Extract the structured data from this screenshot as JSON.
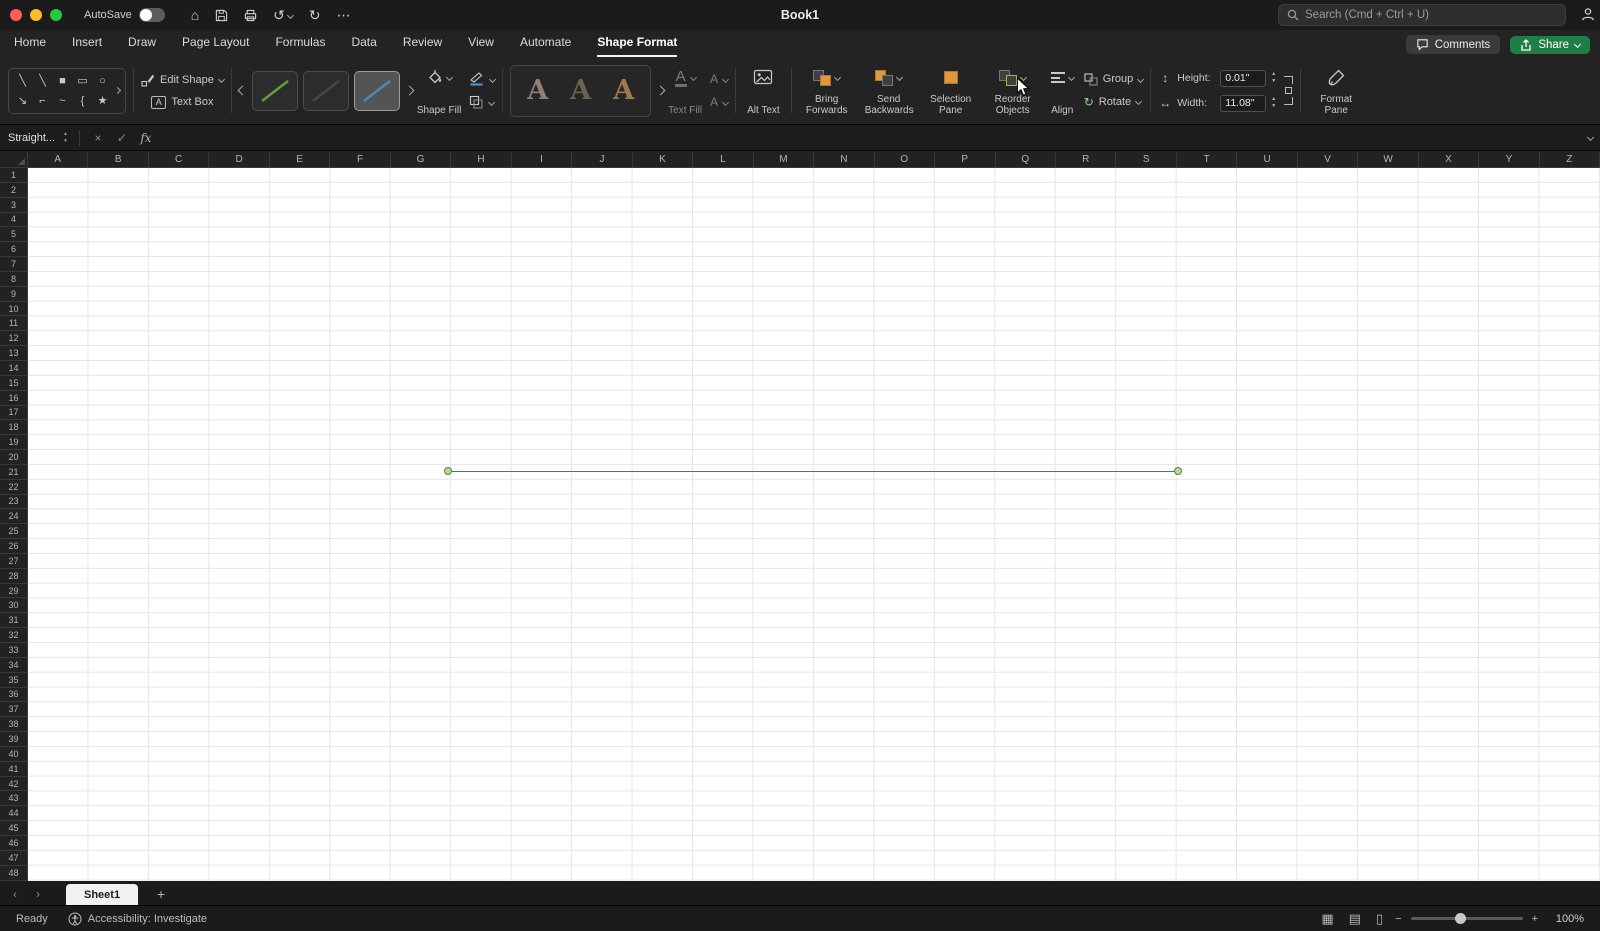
{
  "colors": {
    "share_button_green": "#1e7e45",
    "selected_line_blue": "#41719c",
    "selection_handle_green": "#b9d9a2",
    "selection_handle_border": "#56812f",
    "arrange_icon_orange": "#e0973f",
    "traffic_red": "#ff5f57",
    "traffic_yellow": "#febc2e",
    "traffic_green": "#28c840"
  },
  "icons": {
    "home": "⌂",
    "undo": "↺",
    "redo": "↻",
    "more": "⋯",
    "cancel": "×",
    "confirm": "✓",
    "stepper_up": "▲",
    "stepper_down": "▼",
    "nav_left": "‹",
    "nav_right": "›",
    "add_sheet": "+",
    "zoom_out": "−",
    "zoom_in": "+",
    "view_normal": "▦",
    "view_page_layout": "▤",
    "view_page_break": "▯",
    "height_arrow": "↕",
    "width_arrow": "↔",
    "rotate": "↻",
    "letter_a": "A"
  },
  "titlebar": {
    "autosave_label": "AutoSave",
    "document_title": "Book1",
    "search_placeholder": "Search (Cmd + Ctrl + U)"
  },
  "ribbon_tabs": {
    "items": [
      {
        "label": "Home",
        "active": false
      },
      {
        "label": "Insert",
        "active": false
      },
      {
        "label": "Draw",
        "active": false
      },
      {
        "label": "Page Layout",
        "active": false
      },
      {
        "label": "Formulas",
        "active": false
      },
      {
        "label": "Data",
        "active": false
      },
      {
        "label": "Review",
        "active": false
      },
      {
        "label": "View",
        "active": false
      },
      {
        "label": "Automate",
        "active": false
      },
      {
        "label": "Shape Format",
        "active": true
      }
    ],
    "comments_label": "Comments",
    "share_label": "Share"
  },
  "ribbon": {
    "insert_shapes": {
      "row1": [
        {
          "name": "line-icon",
          "glyph": "╲"
        },
        {
          "name": "line-arrow-icon",
          "glyph": "╲"
        },
        {
          "name": "rectangle-filled-icon",
          "glyph": "■"
        },
        {
          "name": "rectangle-icon",
          "glyph": "▭"
        },
        {
          "name": "oval-icon",
          "glyph": "○"
        }
      ],
      "row2": [
        {
          "name": "arrow-icon",
          "glyph": "↘"
        },
        {
          "name": "elbow-connector-icon",
          "glyph": "⌐"
        },
        {
          "name": "curve-icon",
          "glyph": "~"
        },
        {
          "name": "brace-icon",
          "glyph": "{"
        },
        {
          "name": "star-icon",
          "glyph": "★"
        }
      ]
    },
    "edit_shape_label": "Edit Shape",
    "text_box_label": "Text Box",
    "shape_styles": [
      {
        "name": "line-style-green",
        "color": "#5f9e44",
        "selected": false
      },
      {
        "name": "line-style-dark",
        "color": "#454545",
        "selected": false
      },
      {
        "name": "line-style-blue",
        "color": "#4f87b5",
        "selected": true
      }
    ],
    "shape_fill_label": "Shape Fill",
    "wordart_styles": [
      {
        "letter": "A",
        "color": "#8f8073"
      },
      {
        "letter": "A",
        "color": "#6d6152"
      },
      {
        "letter": "A",
        "color": "#9f7a4e"
      }
    ],
    "text_fill_label": "Text Fill",
    "alt_text_label": "Alt Text",
    "bring_forwards_label": "Bring Forwards",
    "send_backwards_label": "Send Backwards",
    "selection_pane_label": "Selection Pane",
    "reorder_objects_label": "Reorder Objects",
    "align_label": "Align",
    "group_label": "Group",
    "rotate_label": "Rotate",
    "size": {
      "height_label": "Height:",
      "height_value": "0.01\"",
      "width_label": "Width:",
      "width_value": "11.08\""
    },
    "format_pane_label": "Format Pane"
  },
  "formula_bar": {
    "name_box_value": "Straight...",
    "fx_label": "fx"
  },
  "grid": {
    "columns": [
      "A",
      "B",
      "C",
      "D",
      "E",
      "F",
      "G",
      "H",
      "I",
      "J",
      "K",
      "L",
      "M",
      "N",
      "O",
      "P",
      "Q",
      "R",
      "S",
      "T",
      "U",
      "V",
      "W",
      "X",
      "Y",
      "Z"
    ],
    "row_count": 48
  },
  "sheet_bar": {
    "tabs": [
      {
        "label": "Sheet1",
        "active": true
      }
    ]
  },
  "status_bar": {
    "ready_label": "Ready",
    "accessibility_label": "Accessibility: Investigate",
    "zoom_value": "100%"
  }
}
